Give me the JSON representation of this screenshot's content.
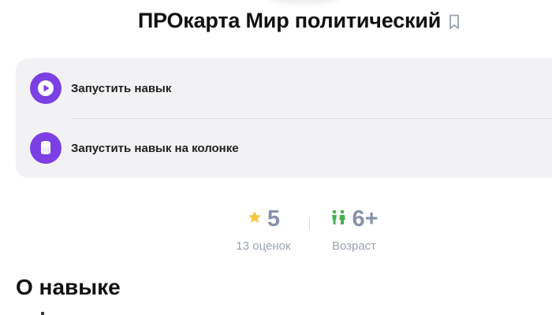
{
  "header": {
    "title": "ПРОкарта Мир политический"
  },
  "actions": [
    {
      "label": "Запустить навык",
      "icon": "play-icon"
    },
    {
      "label": "Запустить навык на колонке",
      "icon": "smart-speaker-icon"
    }
  ],
  "stats": {
    "rating": {
      "value": "5",
      "caption": "13 оценок",
      "icon": "star-icon"
    },
    "age": {
      "value": "6+",
      "caption": "Возраст",
      "icon": "kids-icon"
    }
  },
  "about": {
    "title": "О навыке"
  },
  "colors": {
    "accent": "#7b3fe4",
    "star": "#f7c843",
    "kids": "#4cae4f",
    "stat_text": "#8693a8",
    "card_bg": "#f2f2f4"
  }
}
